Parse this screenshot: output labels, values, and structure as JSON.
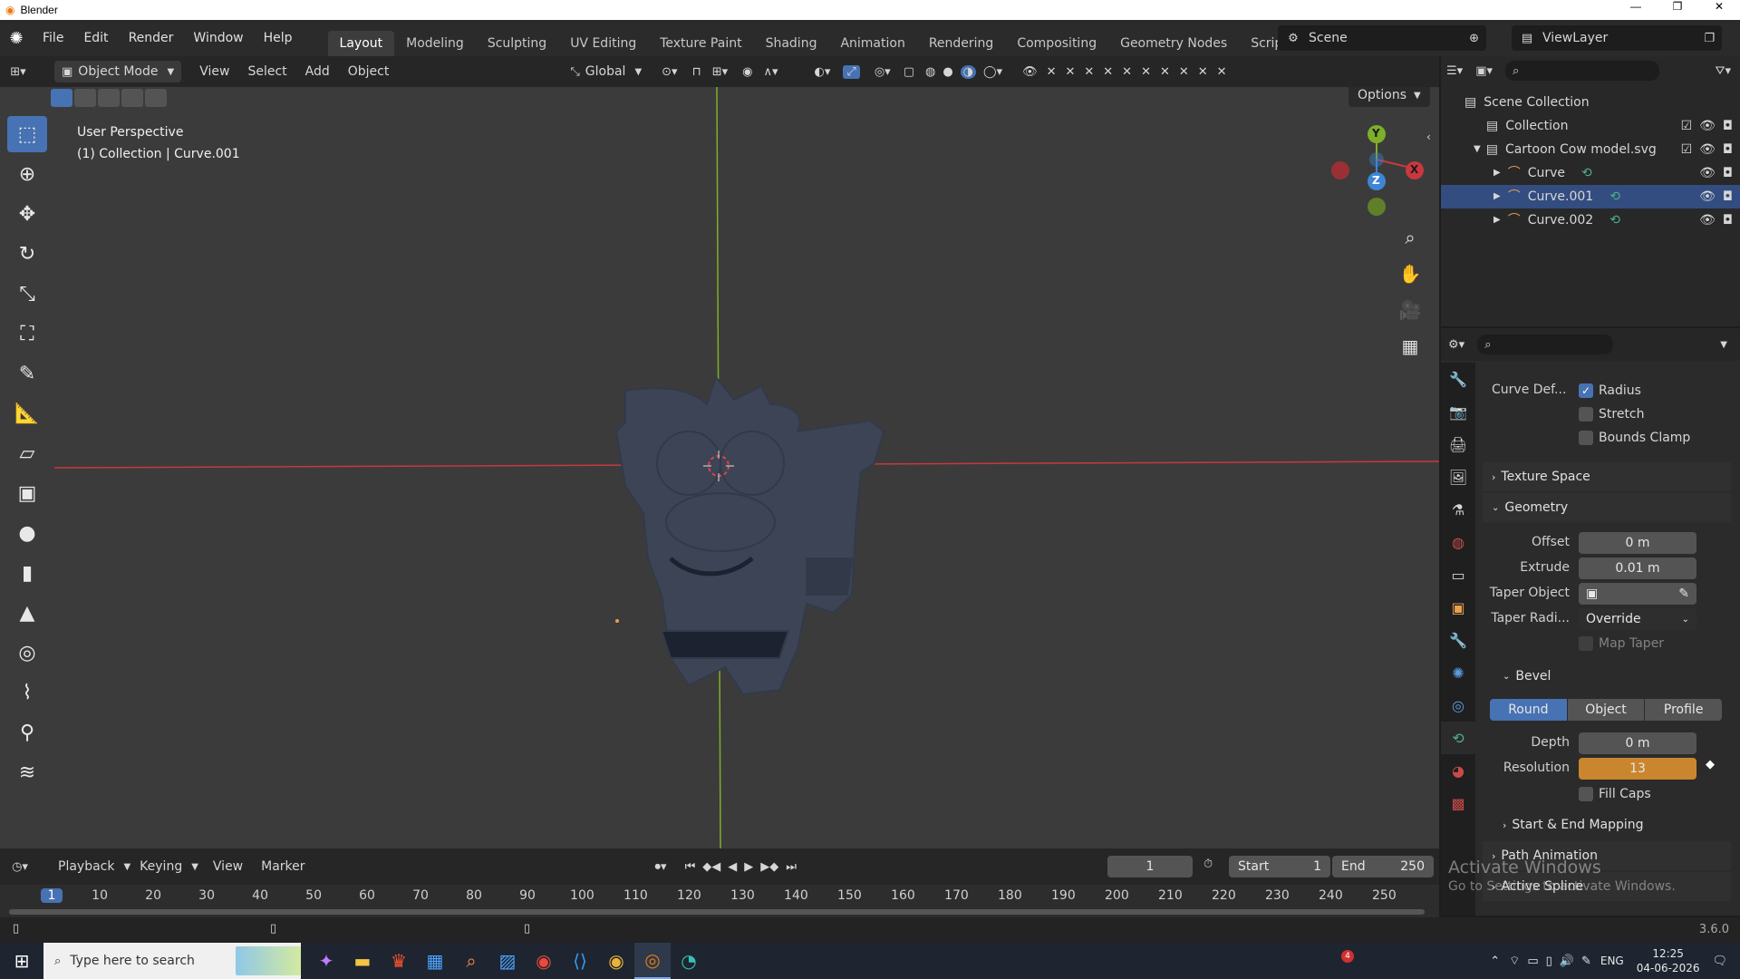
{
  "titlebar": {
    "title": "Blender"
  },
  "menubar": {
    "menus": [
      "File",
      "Edit",
      "Render",
      "Window",
      "Help"
    ],
    "workspaces": [
      "Layout",
      "Modeling",
      "Sculpting",
      "UV Editing",
      "Texture Paint",
      "Shading",
      "Animation",
      "Rendering",
      "Compositing",
      "Geometry Nodes",
      "Scripting"
    ],
    "scene": "Scene",
    "view_layer": "ViewLayer"
  },
  "viewport_header": {
    "mode": "Object Mode",
    "menus": [
      "View",
      "Select",
      "Add",
      "Object"
    ],
    "transform": "Global",
    "options": "Options"
  },
  "viewport": {
    "perspective": "User Perspective",
    "collection_info": "(1) Collection | Curve.001",
    "gizmo": {
      "y": "Y",
      "x": "X",
      "z": "Z"
    }
  },
  "outliner": {
    "root": "Scene Collection",
    "items": [
      {
        "label": "Collection"
      },
      {
        "label": "Cartoon Cow model.svg"
      },
      {
        "label": "Curve"
      },
      {
        "label": "Curve.001"
      },
      {
        "label": "Curve.002"
      }
    ]
  },
  "properties": {
    "curve_deform_label": "Curve Def...",
    "radius": "Radius",
    "stretch": "Stretch",
    "bounds_clamp": "Bounds Clamp",
    "texture_space": "Texture Space",
    "geometry": "Geometry",
    "offset_label": "Offset",
    "offset_value": "0 m",
    "extrude_label": "Extrude",
    "extrude_value": "0.01 m",
    "taper_object_label": "Taper Object",
    "taper_radius_label": "Taper Radi...",
    "taper_radius_value": "Override",
    "map_taper": "Map Taper",
    "bevel": "Bevel",
    "bevel_modes": [
      "Round",
      "Object",
      "Profile"
    ],
    "depth_label": "Depth",
    "depth_value": "0 m",
    "resolution_label": "Resolution",
    "resolution_value": "13",
    "fill_caps": "Fill Caps",
    "start_end_mapping": "Start & End Mapping",
    "path_animation": "Path Animation",
    "active_spline": "Active Spline",
    "watermark_1": "Activate Windows",
    "watermark_2": "Go to Settings to activate Windows."
  },
  "timeline": {
    "menus": [
      "Playback",
      "Keying",
      "View",
      "Marker"
    ],
    "current_frame": "1",
    "start_label": "Start",
    "start_value": "1",
    "end_label": "End",
    "end_value": "250",
    "ticks": [
      "1",
      "10",
      "20",
      "30",
      "40",
      "50",
      "60",
      "70",
      "80",
      "90",
      "100",
      "110",
      "120",
      "130",
      "140",
      "150",
      "160",
      "170",
      "180",
      "190",
      "200",
      "210",
      "220",
      "230",
      "240",
      "250"
    ]
  },
  "statusbar": {
    "version": "3.6.0"
  },
  "taskbar": {
    "search_placeholder": "Type here to search",
    "language": "ENG",
    "time": "12:25",
    "date": "04-06-2026",
    "notification_count": "4"
  },
  "colors": {
    "accent": "#4772b3",
    "keyframe": "#c9862f",
    "x_axis": "#c8383e",
    "y_axis": "#7fae2a",
    "z_axis": "#3d86d6",
    "mesh": "#3c4456"
  }
}
